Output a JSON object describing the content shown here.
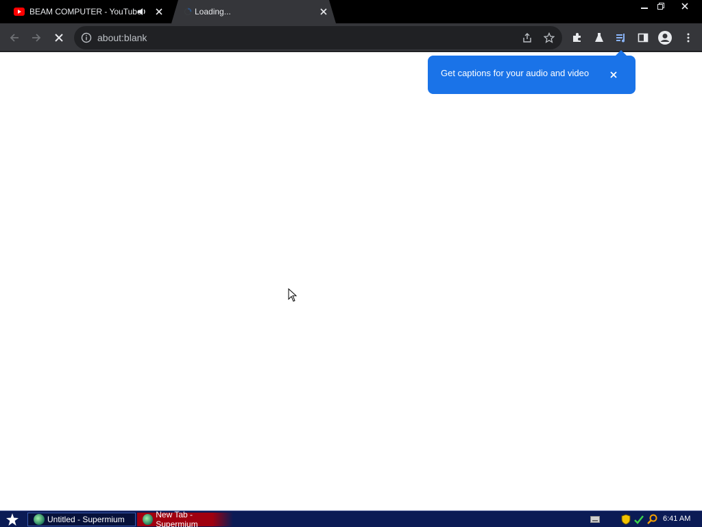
{
  "tabs": [
    {
      "title": "BEAM COMPUTER - YouTube",
      "favicon": "youtube-icon",
      "audio": "speaker-icon",
      "active": false
    },
    {
      "title": "Loading...",
      "favicon": "loading-spinner-icon",
      "active": true
    }
  ],
  "toolbar": {
    "url": "about:blank",
    "icons": [
      "back-arrow-icon",
      "forward-arrow-icon",
      "stop-icon",
      "info-icon",
      "share-icon",
      "star-icon",
      "puzzle-icon",
      "flask-icon",
      "captions-icon",
      "sidepanel-icon",
      "profile-icon",
      "menu-icon"
    ]
  },
  "bubble": {
    "message": "Get captions for your audio and video"
  },
  "taskbar": {
    "items": [
      {
        "label": "Untitled - Supermium"
      },
      {
        "label": "New Tab - Supermium"
      }
    ],
    "clock": "6:41 AM"
  },
  "colors": {
    "accent": "#1a73e8",
    "tabstrip": "#000000",
    "toolbar": "#35363a",
    "taskbar": "#0b1b55"
  }
}
